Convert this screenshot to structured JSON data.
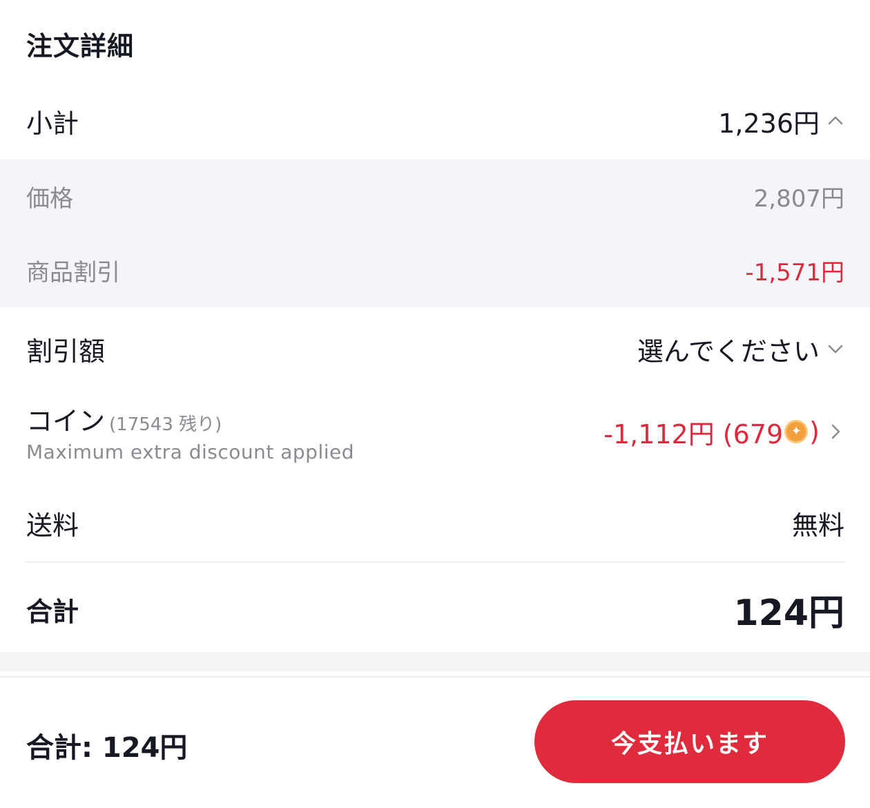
{
  "order_details": {
    "title": "注文詳細",
    "subtotal": {
      "label": "小計",
      "value": "1,236円"
    },
    "price": {
      "label": "価格",
      "value": "2,807円"
    },
    "product_discount": {
      "label": "商品割引",
      "value": "-1,571円"
    },
    "discount_amount": {
      "label": "割引額",
      "value": "選んでください"
    },
    "coins": {
      "label": "コイン",
      "remaining": "(17543 残り)",
      "note": "Maximum extra discount applied",
      "value_prefix": "-1,112円 (679",
      "value_suffix": ")"
    },
    "shipping": {
      "label": "送料",
      "value": "無料"
    },
    "total": {
      "label": "合計",
      "value": "124円"
    }
  },
  "footer": {
    "total_text": "合計: 124円",
    "pay_button": "今支払います"
  },
  "colors": {
    "accent_red": "#df2b3c",
    "discount_red": "#e0283c",
    "muted_text": "#8a8b91",
    "sub_bg": "#f4f5f8"
  }
}
